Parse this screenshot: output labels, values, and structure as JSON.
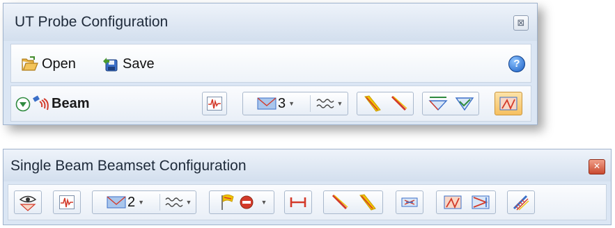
{
  "panel1": {
    "title": "UT Probe Configuration",
    "close_glyph": "⊠",
    "open_label": "Open",
    "save_label": "Save",
    "help_glyph": "?",
    "beam_label": "Beam",
    "element_count": "3"
  },
  "panel2": {
    "title": "Single Beam Beamset Configuration",
    "close_glyph": "✕",
    "element_count": "2"
  },
  "colors": {
    "accent_active": "#f6c061",
    "beam_yellow": "#f2c200",
    "beam_red": "#d33a2a",
    "probe_blue": "#3b6fc8",
    "wave_green": "#2e8a3e"
  },
  "icons": [
    "open-folder-icon",
    "save-icon",
    "help-icon",
    "collapse-arrow-icon",
    "beam-icon",
    "waveform-icon",
    "probe-element-icon",
    "signal-wave-icon",
    "yellow-beam-icon",
    "red-beam-icon",
    "wedge-icon",
    "wedge-check-icon",
    "refraction-icon",
    "eye-icon",
    "flag-icon",
    "stop-icon",
    "ruler-icon",
    "scan-icon",
    "angle-icon",
    "angle-box-icon",
    "array-beams-icon"
  ]
}
